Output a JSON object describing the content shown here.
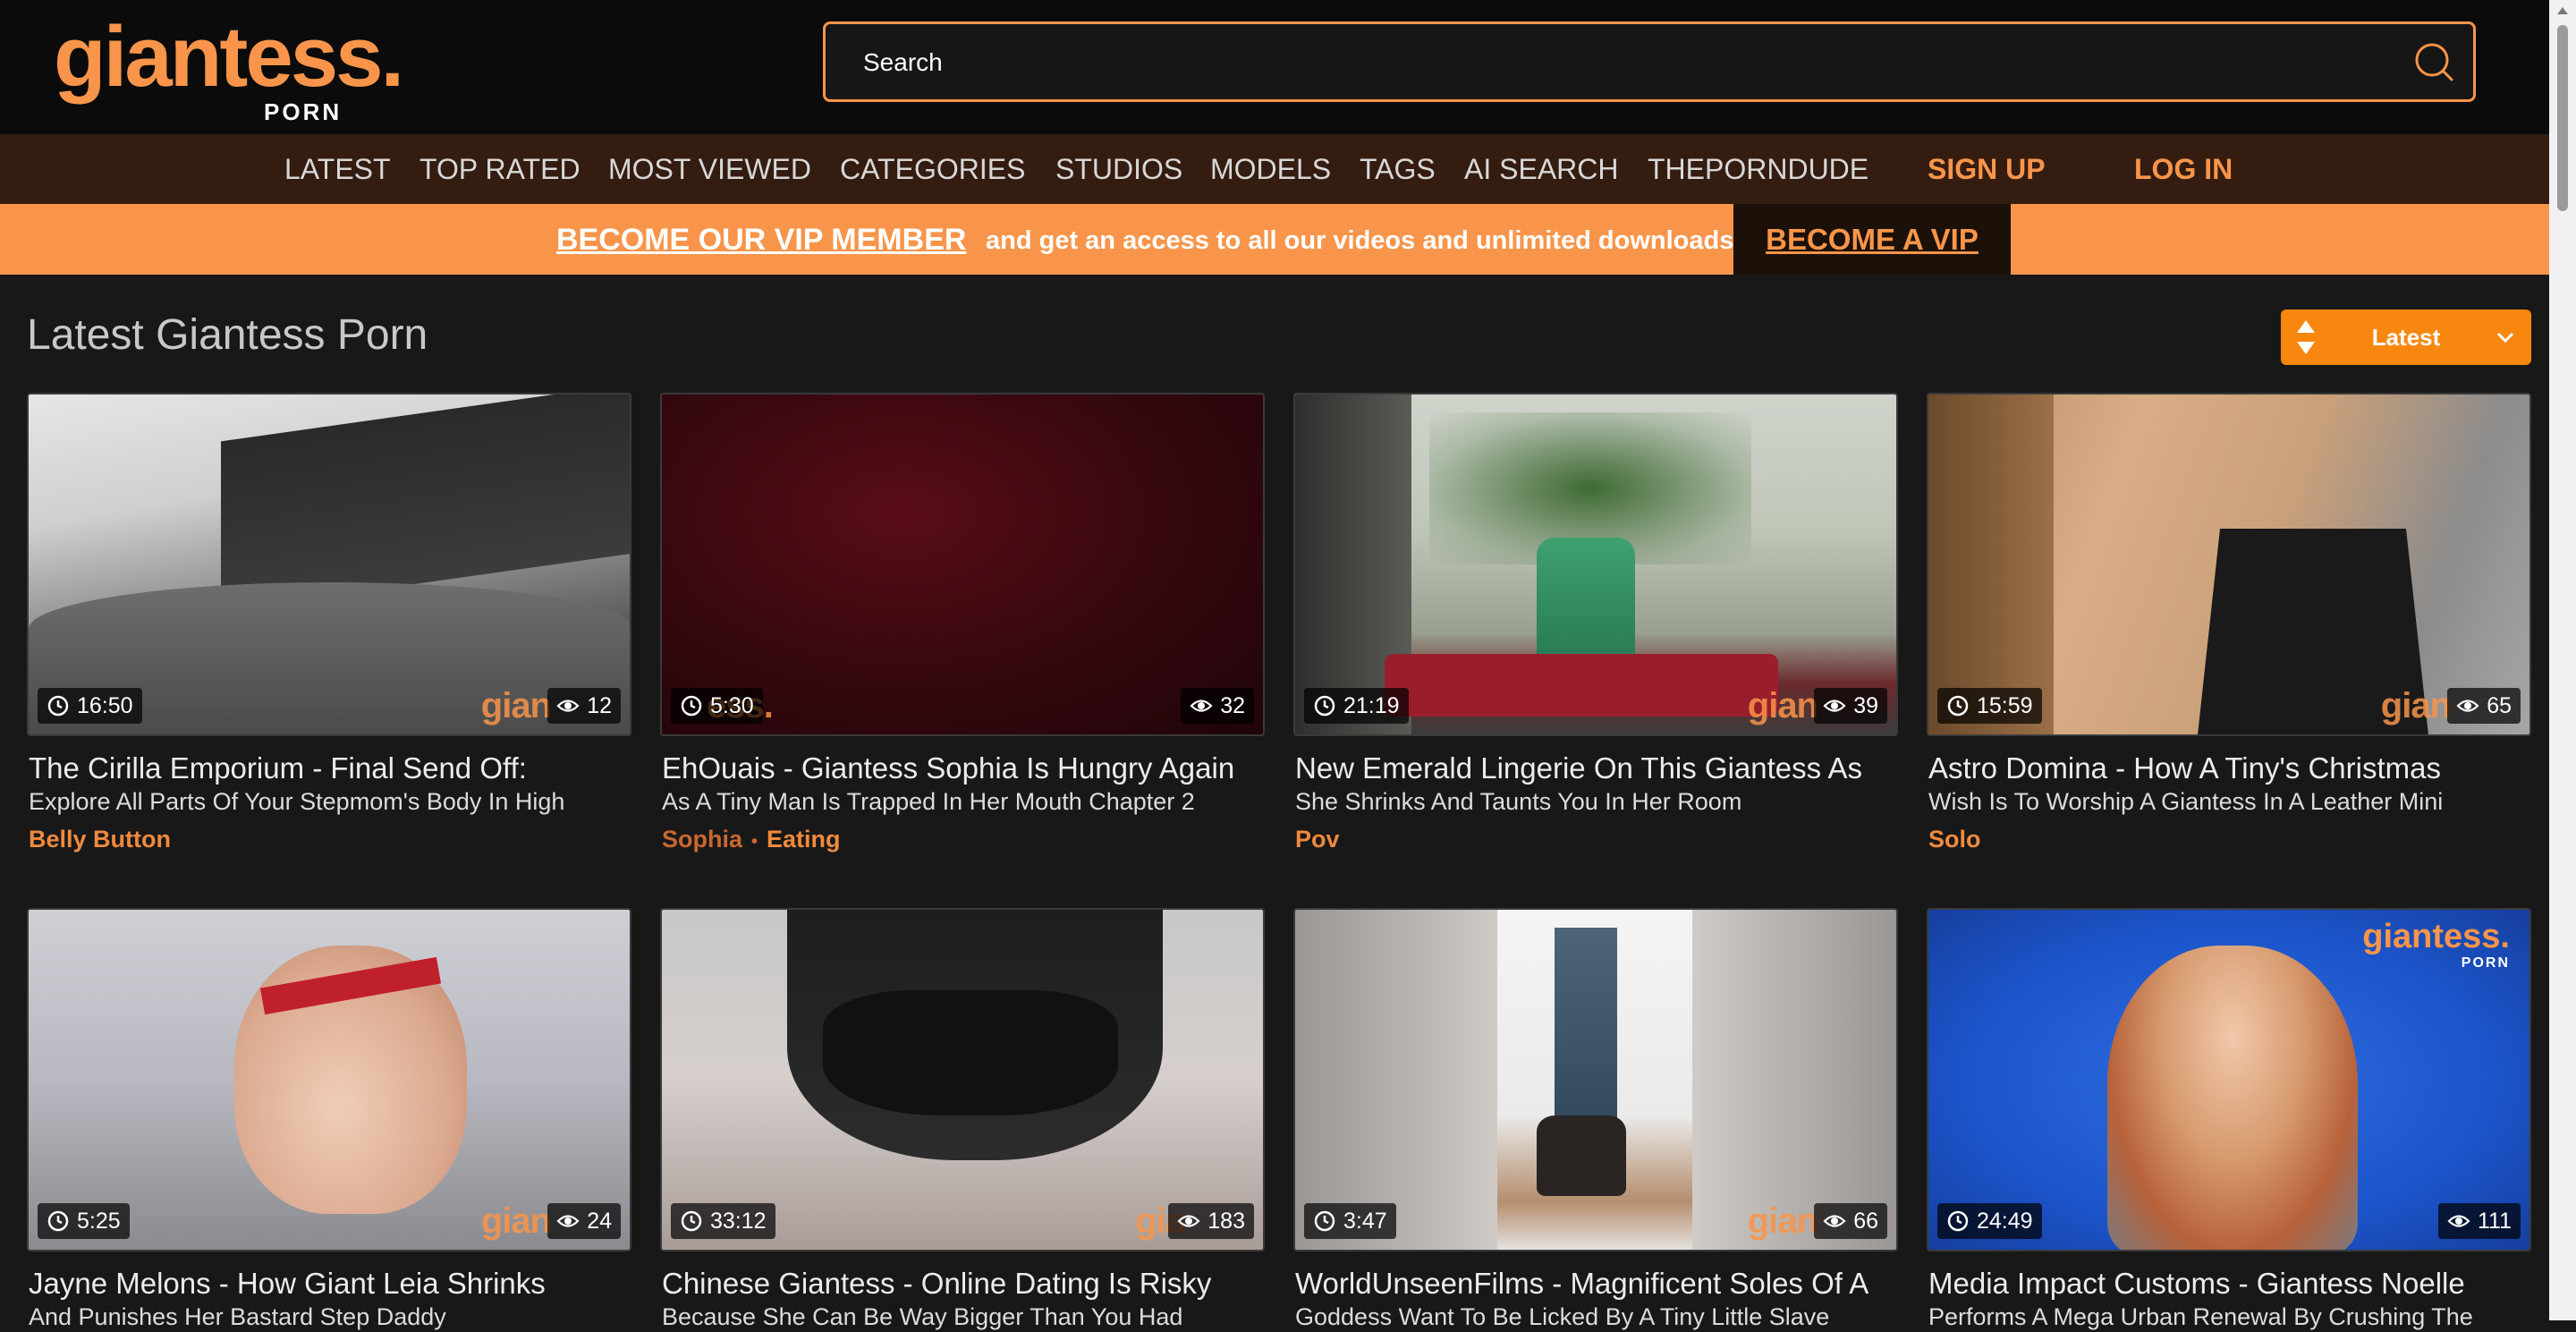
{
  "brand": {
    "name": "giantess.",
    "sub": "PORN"
  },
  "search": {
    "placeholder": "Search"
  },
  "nav": {
    "items": [
      "LATEST",
      "TOP RATED",
      "MOST VIEWED",
      "CATEGORIES",
      "STUDIOS",
      "MODELS",
      "TAGS",
      "AI SEARCH",
      "THEPORNDUDE"
    ],
    "signup": "SIGN UP",
    "login": "LOG IN"
  },
  "vip": {
    "link": "BECOME OUR VIP MEMBER",
    "text": "and get an access to all our videos and unlimited downloads.",
    "button": "BECOME A VIP"
  },
  "page": {
    "title": "Latest Giantess Porn",
    "sort": "Latest"
  },
  "colors": {
    "accent": "#f8954a",
    "background": "#181818",
    "nav_bg": "#341c10",
    "header_bg": "#0b0b0b"
  },
  "videos": [
    {
      "duration": "16:50",
      "views": "12",
      "title1": "The Cirilla Emporium - Final Send Off:",
      "title2": "Explore All Parts Of Your Stepmom's Body In High",
      "tags": [
        "Belly Button"
      ],
      "watermark": "gian"
    },
    {
      "duration": "5:30",
      "views": "32",
      "title1": "EhOuais - Giantess Sophia Is Hungry Again",
      "title2": "As A Tiny Man Is Trapped In Her Mouth Chapter 2",
      "tags": [
        "Sophia",
        "Eating"
      ],
      "watermark": "ess."
    },
    {
      "duration": "21:19",
      "views": "39",
      "title1": "New Emerald Lingerie On This Giantess As",
      "title2": "She Shrinks And Taunts You In Her Room",
      "tags": [
        "Pov"
      ],
      "watermark": "gian"
    },
    {
      "duration": "15:59",
      "views": "65",
      "title1": "Astro Domina - How A Tiny's Christmas",
      "title2": "Wish Is To Worship A Giantess In A Leather Mini",
      "tags": [
        "Solo"
      ],
      "watermark": "gian"
    },
    {
      "duration": "5:25",
      "views": "24",
      "title1": "Jayne Melons - How Giant Leia Shrinks",
      "title2": "And Punishes Her Bastard Step Daddy",
      "tags": [],
      "watermark": "gian"
    },
    {
      "duration": "33:12",
      "views": "183",
      "title1": "Chinese Giantess - Online Dating Is Risky",
      "title2": "Because She Can Be Way Bigger Than You Had",
      "tags": [],
      "watermark": "gia"
    },
    {
      "duration": "3:47",
      "views": "66",
      "title1": "WorldUnseenFilms - Magnificent Soles Of A",
      "title2": "Goddess Want To Be Licked By A Tiny Little Slave",
      "tags": [],
      "watermark": "gian"
    },
    {
      "duration": "24:49",
      "views": "111",
      "title1": "Media Impact Customs - Giantess Noelle",
      "title2": "Performs A Mega Urban Renewal By Crushing The",
      "tags": [],
      "watermark": "giantess."
    }
  ]
}
